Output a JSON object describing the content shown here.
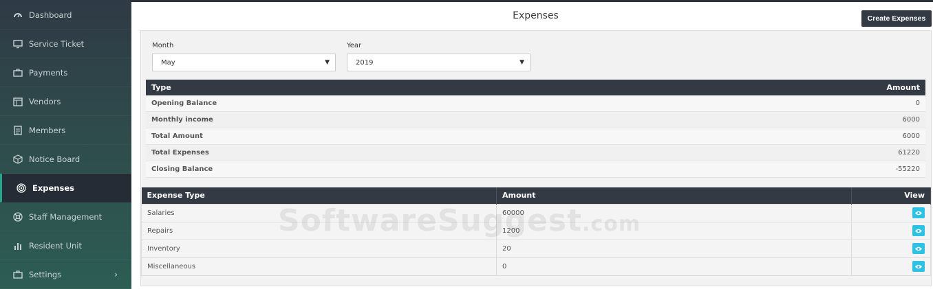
{
  "sidebar": {
    "items": [
      {
        "label": "Dashboard",
        "icon": "dashboard-icon"
      },
      {
        "label": "Service Ticket",
        "icon": "monitor-icon"
      },
      {
        "label": "Payments",
        "icon": "briefcase-icon"
      },
      {
        "label": "Vendors",
        "icon": "calendar-icon"
      },
      {
        "label": "Members",
        "icon": "document-icon"
      },
      {
        "label": "Notice Board",
        "icon": "cube-icon"
      },
      {
        "label": "Expenses",
        "icon": "target-icon"
      },
      {
        "label": "Staff Management",
        "icon": "lifebuoy-icon"
      },
      {
        "label": "Resident Unit",
        "icon": "bar-chart-icon"
      },
      {
        "label": "Settings",
        "icon": "briefcase-icon"
      }
    ],
    "active": "Expenses"
  },
  "header": {
    "title": "Expenses",
    "create_button": "Create Expenses"
  },
  "filters": {
    "month_label": "Month",
    "month_value": "May",
    "year_label": "Year",
    "year_value": "2019"
  },
  "summary": {
    "headers": [
      "Type",
      "Amount"
    ],
    "rows": [
      {
        "type": "Opening Balance",
        "amount": "0"
      },
      {
        "type": "Monthly income",
        "amount": "6000"
      },
      {
        "type": "Total Amount",
        "amount": "6000"
      },
      {
        "type": "Total Expenses",
        "amount": "61220"
      },
      {
        "type": "Closing Balance",
        "amount": "-55220"
      }
    ]
  },
  "expenses": {
    "headers": [
      "Expense Type",
      "Amount",
      "View"
    ],
    "rows": [
      {
        "type": "Salaries",
        "amount": "60000"
      },
      {
        "type": "Repairs",
        "amount": "1200"
      },
      {
        "type": "Inventory",
        "amount": "20"
      },
      {
        "type": "Miscellaneous",
        "amount": "0"
      }
    ]
  },
  "watermark": {
    "main": "SoftwareSuggest",
    "suffix": ".com"
  },
  "colors": {
    "accent": "#24a38d",
    "dark": "#333a44",
    "view_button": "#2dc1e3"
  }
}
